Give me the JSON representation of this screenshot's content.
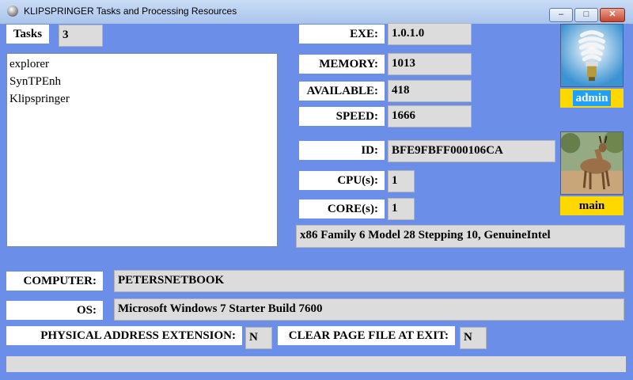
{
  "window": {
    "title": "KLIPSPRINGER Tasks and Processing Resources"
  },
  "tasks": {
    "label": "Tasks",
    "count": "3",
    "items": [
      "explorer",
      "SynTPEnh",
      "Klipspringer"
    ]
  },
  "fields": {
    "exe": {
      "label": "EXE:",
      "value": "1.0.1.0"
    },
    "memory": {
      "label": "MEMORY:",
      "value": "1013"
    },
    "available": {
      "label": "AVAILABLE:",
      "value": "418"
    },
    "speed": {
      "label": "SPEED:",
      "value": "1666"
    },
    "id": {
      "label": "ID:",
      "value": "BFE9FBFF000106CA"
    },
    "cpus": {
      "label": "CPU(s):",
      "value": "1"
    },
    "cores": {
      "label": "CORE(s):",
      "value": "1"
    },
    "processor": {
      "value": "x86 Family 6 Model 28 Stepping 10, GenuineIntel"
    },
    "computer": {
      "label": "COMPUTER:",
      "value": "PETERSNETBOOK"
    },
    "os": {
      "label": "OS:",
      "value": "Microsoft Windows 7 Starter  Build 7600"
    },
    "pae": {
      "label": "PHYSICAL ADDRESS EXTENSION:",
      "value": "N"
    },
    "clear_page": {
      "label": "CLEAR PAGE FILE AT EXIT:",
      "value": "N"
    }
  },
  "user": {
    "label": "admin",
    "icon": "light-bulb-icon"
  },
  "thread": {
    "label": "main",
    "icon": "antelope-image"
  },
  "colors": {
    "background": "#6b8fe8",
    "value_box": "#dcdcdc",
    "caption": "#ffd800",
    "admin_caption": "#1fa0ff"
  }
}
